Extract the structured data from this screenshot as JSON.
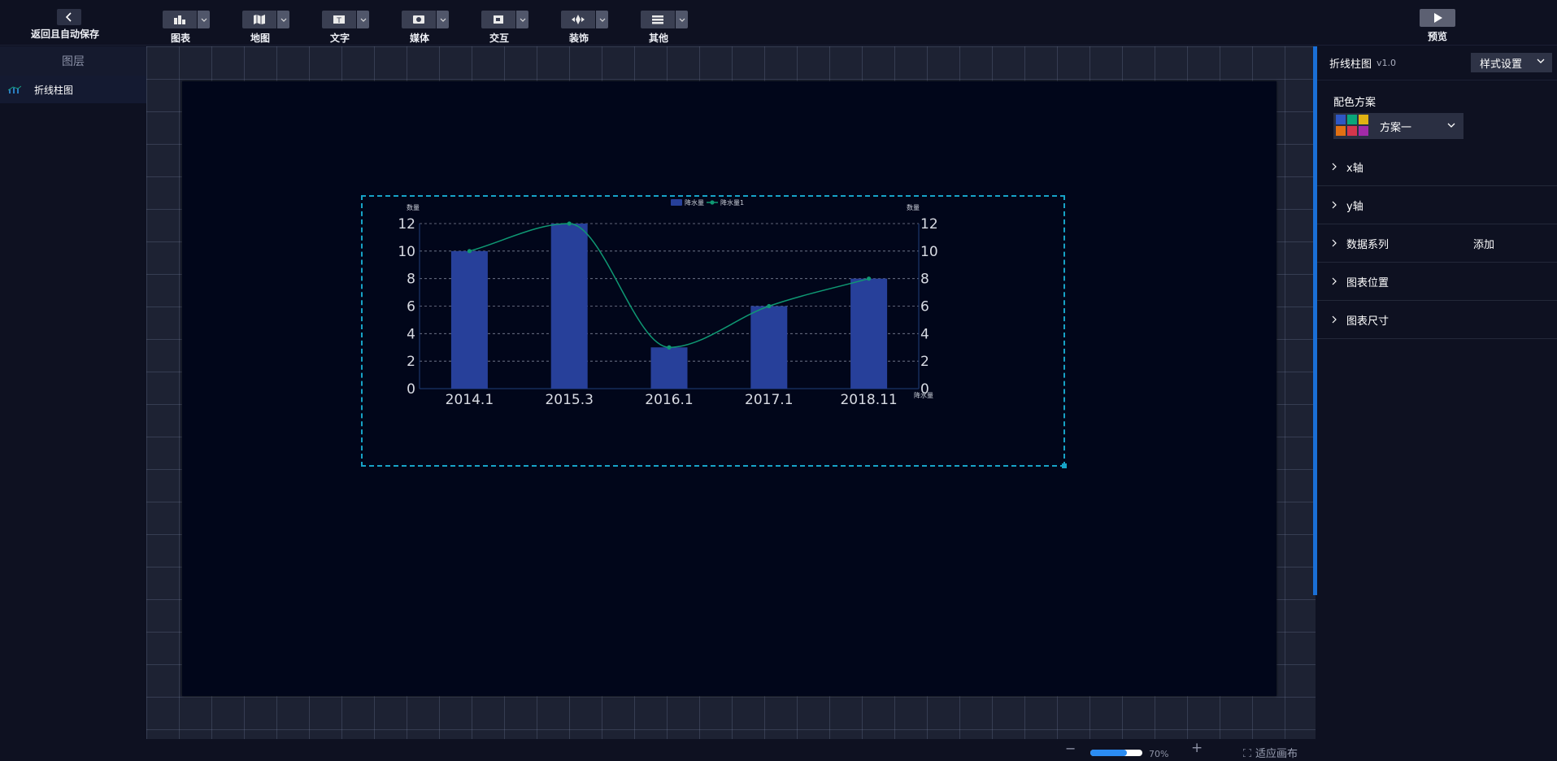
{
  "toolbar": {
    "back_label": "返回且自动保存",
    "tools": [
      {
        "label": "图表",
        "icon": "chart-icon"
      },
      {
        "label": "地图",
        "icon": "map-icon"
      },
      {
        "label": "文字",
        "icon": "text-icon"
      },
      {
        "label": "媒体",
        "icon": "media-icon"
      },
      {
        "label": "交互",
        "icon": "interaction-icon"
      },
      {
        "label": "装饰",
        "icon": "decoration-icon"
      },
      {
        "label": "其他",
        "icon": "other-icon"
      }
    ],
    "preview_label": "预览"
  },
  "layers": {
    "title": "图层",
    "items": [
      {
        "label": "折线柱图",
        "icon": "bar-line-chart-icon"
      }
    ]
  },
  "chart_data": {
    "type": "bar",
    "categories": [
      "2014.1",
      "2015.3",
      "2016.1",
      "2017.1",
      "2018.11"
    ],
    "series": [
      {
        "name": "降水量",
        "type": "bar",
        "values": [
          10,
          12,
          3,
          6,
          8
        ],
        "color": "#27409a"
      },
      {
        "name": "降水量1",
        "type": "line",
        "smooth": true,
        "values": [
          10,
          12,
          3,
          6,
          8
        ],
        "color": "#0f9873"
      }
    ],
    "ylabel_left": "数量",
    "ylabel_right": "数量",
    "xlabel": "降水量",
    "yticks": [
      0,
      2,
      4,
      6,
      8,
      10,
      12
    ],
    "ylim": [
      0,
      12
    ],
    "grid": true,
    "legend": "top-center"
  },
  "bottom": {
    "zoom_value": "70%",
    "zoom_fraction": 0.7,
    "fit_label": "适应画布"
  },
  "right_panel": {
    "title": "折线柱图",
    "version": "v1.0",
    "style_button": "样式设置",
    "color_scheme_label": "配色方案",
    "color_scheme_value": "方案一",
    "swatch_colors": [
      "#2f57c4",
      "#0aa77a",
      "#e0b213",
      "#e27012",
      "#d5364c",
      "#a22aa8"
    ],
    "sections": [
      {
        "label": "x轴",
        "action": ""
      },
      {
        "label": "y轴",
        "action": ""
      },
      {
        "label": "数据系列",
        "action": "添加"
      },
      {
        "label": "图表位置",
        "action": ""
      },
      {
        "label": "图表尺寸",
        "action": ""
      }
    ]
  }
}
